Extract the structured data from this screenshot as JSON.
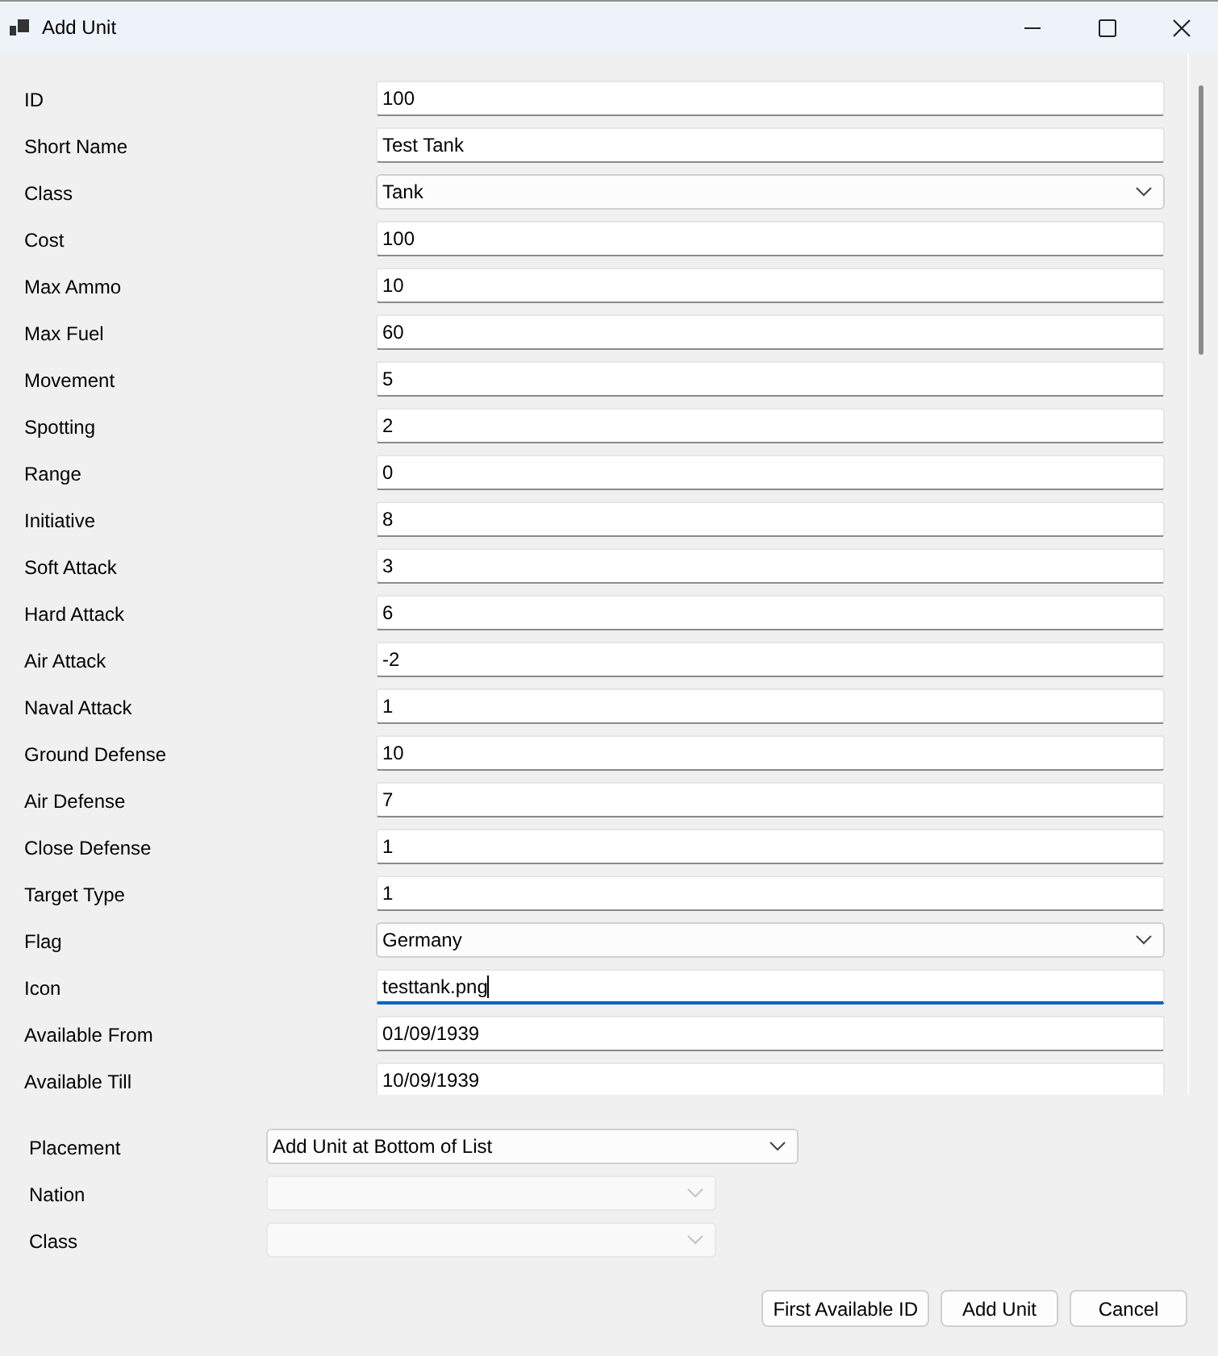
{
  "window": {
    "title": "Add Unit"
  },
  "fields": [
    {
      "label": "ID",
      "kind": "text",
      "value": "100",
      "focused": false
    },
    {
      "label": "Short Name",
      "kind": "text",
      "value": "Test Tank",
      "focused": false
    },
    {
      "label": "Class",
      "kind": "dropdown",
      "value": "Tank",
      "focused": false
    },
    {
      "label": "Cost",
      "kind": "text",
      "value": "100",
      "focused": false
    },
    {
      "label": "Max Ammo",
      "kind": "text",
      "value": "10",
      "focused": false
    },
    {
      "label": "Max Fuel",
      "kind": "text",
      "value": "60",
      "focused": false
    },
    {
      "label": "Movement",
      "kind": "text",
      "value": "5",
      "focused": false
    },
    {
      "label": "Spotting",
      "kind": "text",
      "value": "2",
      "focused": false
    },
    {
      "label": "Range",
      "kind": "text",
      "value": "0",
      "focused": false
    },
    {
      "label": "Initiative",
      "kind": "text",
      "value": "8",
      "focused": false
    },
    {
      "label": "Soft Attack",
      "kind": "text",
      "value": "3",
      "focused": false
    },
    {
      "label": "Hard Attack",
      "kind": "text",
      "value": "6",
      "focused": false
    },
    {
      "label": "Air Attack",
      "kind": "text",
      "value": "-2",
      "focused": false
    },
    {
      "label": "Naval Attack",
      "kind": "text",
      "value": "1",
      "focused": false
    },
    {
      "label": "Ground Defense",
      "kind": "text",
      "value": "10",
      "focused": false
    },
    {
      "label": "Air Defense",
      "kind": "text",
      "value": "7",
      "focused": false
    },
    {
      "label": "Close Defense",
      "kind": "text",
      "value": "1",
      "focused": false
    },
    {
      "label": "Target Type",
      "kind": "text",
      "value": "1",
      "focused": false
    },
    {
      "label": "Flag",
      "kind": "dropdown",
      "value": "Germany",
      "focused": false
    },
    {
      "label": "Icon",
      "kind": "text",
      "value": "testtank.png",
      "focused": true
    },
    {
      "label": "Available From",
      "kind": "text",
      "value": "01/09/1939",
      "focused": false
    },
    {
      "label": "Available Till",
      "kind": "text",
      "value": "10/09/1939",
      "focused": false
    }
  ],
  "options": [
    {
      "label": "Placement",
      "value": "Add Unit at Bottom of List",
      "disabled": false
    },
    {
      "label": "Nation",
      "disabled": true
    },
    {
      "label": "Class",
      "disabled": true
    }
  ],
  "buttons": [
    "First Available ID",
    "Add Unit",
    "Cancel"
  ]
}
